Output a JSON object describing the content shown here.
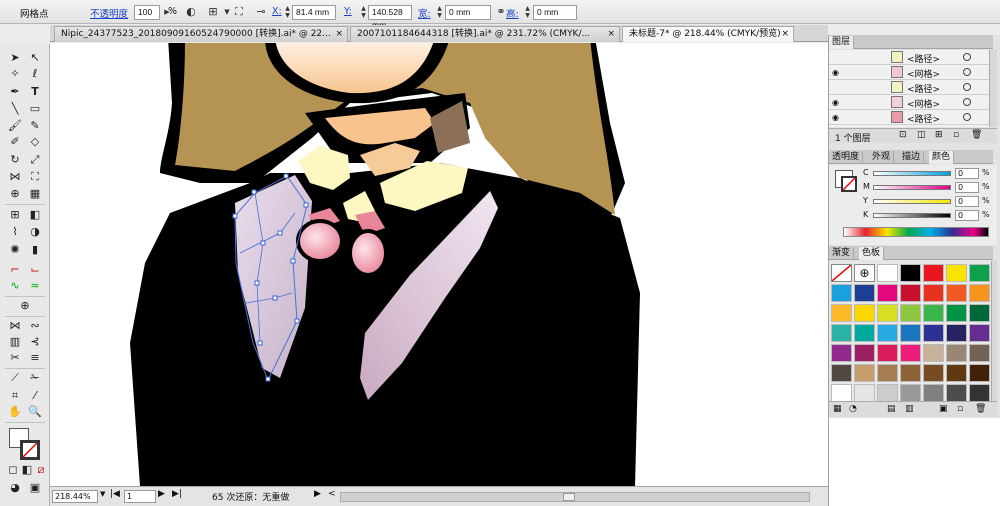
{
  "control_bar": {
    "object_type": "网格点",
    "opacity_label": "不透明度",
    "opacity_value": "100",
    "opacity_unit": "%",
    "x_label": "X:",
    "x_value": "81.4 mm",
    "y_label": "Y:",
    "y_value": "140.528 mm",
    "width_label": "宽:",
    "width_value": "0 mm",
    "height_label": "高:",
    "height_value": "0 mm"
  },
  "tabs": [
    {
      "label": "Nipic_24377523_20180909160524790000  [转换].ai* @ 22...",
      "active": false
    },
    {
      "label": "20071011846443​18  [转换].ai* @ 231.72% (CMYK/...",
      "active": false
    },
    {
      "label": "未标题-7* @ 218.44% (CMYK/预览)",
      "active": true
    }
  ],
  "status": {
    "zoom": "218.44%",
    "artboard": "1",
    "history": "65 次还原：无重做"
  },
  "layers_panel": {
    "title": "图层",
    "rows": [
      {
        "name": "<路径>",
        "visible": false,
        "thumb": "#f4efc0"
      },
      {
        "name": "<网格>",
        "visible": true,
        "thumb": "#f0c9cf"
      },
      {
        "name": "<路径>",
        "visible": false,
        "thumb": "#f6f0c8"
      },
      {
        "name": "<网格>",
        "visible": true,
        "thumb": "#f2d2d8"
      },
      {
        "name": "<路径>",
        "visible": true,
        "thumb": "#e89aa8"
      }
    ],
    "footer": "1 个图层"
  },
  "color_panel": {
    "tabs": [
      "透明度",
      "外观",
      "描边",
      "颜色"
    ],
    "active_tab": "颜色",
    "channels": [
      {
        "label": "C",
        "value": "0",
        "unit": "%",
        "color": "#00a0e0"
      },
      {
        "label": "M",
        "value": "0",
        "unit": "%",
        "color": "#e0008a"
      },
      {
        "label": "Y",
        "value": "0",
        "unit": "%",
        "color": "#f3e600"
      },
      {
        "label": "K",
        "value": "0",
        "unit": "%",
        "color": "#000000"
      }
    ]
  },
  "swatches_panel": {
    "tabs": [
      "渐变",
      "色板"
    ],
    "active_tab": "色板",
    "colors": [
      "none",
      "registration",
      "#ffffff",
      "#000000",
      "#e8161e",
      "#f9e400",
      "#0ea04a",
      "#1aa0dc",
      "#1c3e94",
      "#e4087e",
      "#c8102e",
      "#e6321e",
      "#f05a22",
      "#f7941d",
      "#fcb827",
      "#fdd700",
      "#d7df23",
      "#8dc63f",
      "#39b54a",
      "#009444",
      "#006838",
      "#2bb2a6",
      "#00a99d",
      "#27aae1",
      "#1b75bc",
      "#2e3192",
      "#262262",
      "#662d91",
      "#92278f",
      "#9e1f63",
      "#da1c5c",
      "#ed1e79",
      "#c7b299",
      "#998675",
      "#736357",
      "#534741",
      "#c69c6d",
      "#a67c52",
      "#8c6239",
      "#754c24",
      "#603913",
      "#42210b",
      "#ffffff",
      "#e6e6e6",
      "#cccccc",
      "#999999",
      "#808080",
      "#4d4d4d",
      "#333333"
    ]
  }
}
